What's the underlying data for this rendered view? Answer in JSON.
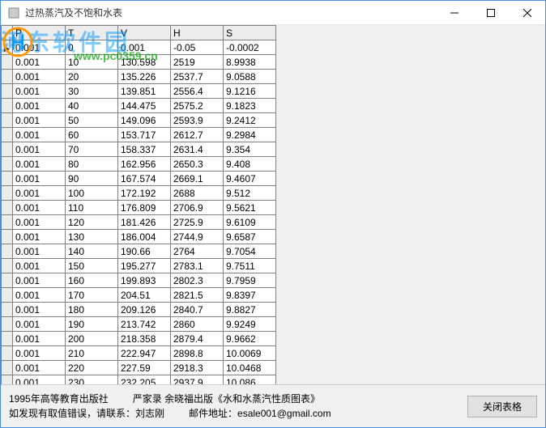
{
  "window": {
    "title": "过热蒸汽及不饱和水表"
  },
  "watermark": {
    "text": "河东软件园",
    "url": "www.pc0359.cn"
  },
  "table": {
    "headers": [
      "P",
      "T",
      "V",
      "H",
      "S"
    ],
    "rows": [
      [
        "0.001",
        "0",
        "0.001",
        "-0.05",
        "-0.0002"
      ],
      [
        "0.001",
        "10",
        "130.598",
        "2519",
        "8.9938"
      ],
      [
        "0.001",
        "20",
        "135.226",
        "2537.7",
        "9.0588"
      ],
      [
        "0.001",
        "30",
        "139.851",
        "2556.4",
        "9.1216"
      ],
      [
        "0.001",
        "40",
        "144.475",
        "2575.2",
        "9.1823"
      ],
      [
        "0.001",
        "50",
        "149.096",
        "2593.9",
        "9.2412"
      ],
      [
        "0.001",
        "60",
        "153.717",
        "2612.7",
        "9.2984"
      ],
      [
        "0.001",
        "70",
        "158.337",
        "2631.4",
        "9.354"
      ],
      [
        "0.001",
        "80",
        "162.956",
        "2650.3",
        "9.408"
      ],
      [
        "0.001",
        "90",
        "167.574",
        "2669.1",
        "9.4607"
      ],
      [
        "0.001",
        "100",
        "172.192",
        "2688",
        "9.512"
      ],
      [
        "0.001",
        "110",
        "176.809",
        "2706.9",
        "9.5621"
      ],
      [
        "0.001",
        "120",
        "181.426",
        "2725.9",
        "9.6109"
      ],
      [
        "0.001",
        "130",
        "186.004",
        "2744.9",
        "9.6587"
      ],
      [
        "0.001",
        "140",
        "190.66",
        "2764",
        "9.7054"
      ],
      [
        "0.001",
        "150",
        "195.277",
        "2783.1",
        "9.7511"
      ],
      [
        "0.001",
        "160",
        "199.893",
        "2802.3",
        "9.7959"
      ],
      [
        "0.001",
        "170",
        "204.51",
        "2821.5",
        "9.8397"
      ],
      [
        "0.001",
        "180",
        "209.126",
        "2840.7",
        "9.8827"
      ],
      [
        "0.001",
        "190",
        "213.742",
        "2860",
        "9.9249"
      ],
      [
        "0.001",
        "200",
        "218.358",
        "2879.4",
        "9.9662"
      ],
      [
        "0.001",
        "210",
        "222.947",
        "2898.8",
        "10.0069"
      ],
      [
        "0.001",
        "220",
        "227.59",
        "2918.3",
        "10.0468"
      ],
      [
        "0.001",
        "230",
        "232.205",
        "2937.9",
        "10.086"
      ]
    ]
  },
  "footer": {
    "line1a": "1995年高等教育出版社",
    "line1b": "严家录 余晓福出版《水和水蒸汽性质图表》",
    "line2a": "如发现有取值错误，请联系：刘志刚",
    "line2b": "邮件地址：esale001@gmail.com",
    "close_label": "关闭表格"
  }
}
